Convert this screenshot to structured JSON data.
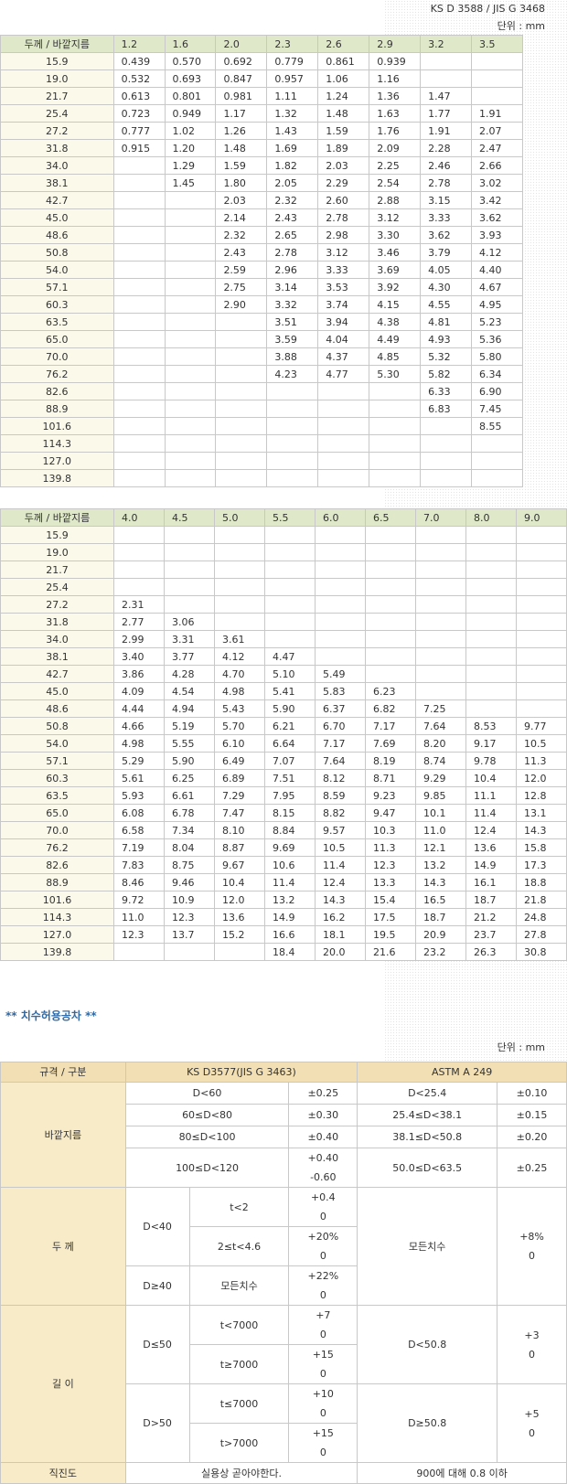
{
  "standard": "KS D 3588 / JIS G 3468",
  "unit": "단위 : mm",
  "weight_table": {
    "corner": "두께 / 바깥지름",
    "od": [
      "15.9",
      "19.0",
      "21.7",
      "25.4",
      "27.2",
      "31.8",
      "34.0",
      "38.1",
      "42.7",
      "45.0",
      "48.6",
      "50.8",
      "54.0",
      "57.1",
      "60.3",
      "63.5",
      "65.0",
      "70.0",
      "76.2",
      "82.6",
      "88.9",
      "101.6",
      "114.3",
      "127.0",
      "139.8"
    ],
    "part1": {
      "thickness": [
        "1.2",
        "1.6",
        "2.0",
        "2.3",
        "2.6",
        "2.9",
        "3.2",
        "3.5"
      ],
      "rows": [
        [
          "0.439",
          "0.570",
          "0.692",
          "0.779",
          "0.861",
          "0.939",
          "",
          ""
        ],
        [
          "0.532",
          "0.693",
          "0.847",
          "0.957",
          "1.06",
          "1.16",
          "",
          ""
        ],
        [
          "0.613",
          "0.801",
          "0.981",
          "1.11",
          "1.24",
          "1.36",
          "1.47",
          ""
        ],
        [
          "0.723",
          "0.949",
          "1.17",
          "1.32",
          "1.48",
          "1.63",
          "1.77",
          "1.91"
        ],
        [
          "0.777",
          "1.02",
          "1.26",
          "1.43",
          "1.59",
          "1.76",
          "1.91",
          "2.07"
        ],
        [
          "0.915",
          "1.20",
          "1.48",
          "1.69",
          "1.89",
          "2.09",
          "2.28",
          "2.47"
        ],
        [
          "",
          "1.29",
          "1.59",
          "1.82",
          "2.03",
          "2.25",
          "2.46",
          "2.66"
        ],
        [
          "",
          "1.45",
          "1.80",
          "2.05",
          "2.29",
          "2.54",
          "2.78",
          "3.02"
        ],
        [
          "",
          "",
          "2.03",
          "2.32",
          "2.60",
          "2.88",
          "3.15",
          "3.42"
        ],
        [
          "",
          "",
          "2.14",
          "2.43",
          "2.78",
          "3.12",
          "3.33",
          "3.62"
        ],
        [
          "",
          "",
          "2.32",
          "2.65",
          "2.98",
          "3.30",
          "3.62",
          "3.93"
        ],
        [
          "",
          "",
          "2.43",
          "2.78",
          "3.12",
          "3.46",
          "3.79",
          "4.12"
        ],
        [
          "",
          "",
          "2.59",
          "2.96",
          "3.33",
          "3.69",
          "4.05",
          "4.40"
        ],
        [
          "",
          "",
          "2.75",
          "3.14",
          "3.53",
          "3.92",
          "4.30",
          "4.67"
        ],
        [
          "",
          "",
          "2.90",
          "3.32",
          "3.74",
          "4.15",
          "4.55",
          "4.95"
        ],
        [
          "",
          "",
          "",
          "3.51",
          "3.94",
          "4.38",
          "4.81",
          "5.23"
        ],
        [
          "",
          "",
          "",
          "3.59",
          "4.04",
          "4.49",
          "4.93",
          "5.36"
        ],
        [
          "",
          "",
          "",
          "3.88",
          "4.37",
          "4.85",
          "5.32",
          "5.80"
        ],
        [
          "",
          "",
          "",
          "4.23",
          "4.77",
          "5.30",
          "5.82",
          "6.34"
        ],
        [
          "",
          "",
          "",
          "",
          "",
          "",
          "6.33",
          "6.90"
        ],
        [
          "",
          "",
          "",
          "",
          "",
          "",
          "6.83",
          "7.45"
        ],
        [
          "",
          "",
          "",
          "",
          "",
          "",
          "",
          "8.55"
        ],
        [
          "",
          "",
          "",
          "",
          "",
          "",
          "",
          ""
        ],
        [
          "",
          "",
          "",
          "",
          "",
          "",
          "",
          ""
        ],
        [
          "",
          "",
          "",
          "",
          "",
          "",
          "",
          ""
        ]
      ]
    },
    "part2": {
      "thickness": [
        "4.0",
        "4.5",
        "5.0",
        "5.5",
        "6.0",
        "6.5",
        "7.0",
        "8.0",
        "9.0"
      ],
      "rows": [
        [
          "",
          "",
          "",
          "",
          "",
          "",
          "",
          "",
          ""
        ],
        [
          "",
          "",
          "",
          "",
          "",
          "",
          "",
          "",
          ""
        ],
        [
          "",
          "",
          "",
          "",
          "",
          "",
          "",
          "",
          ""
        ],
        [
          "",
          "",
          "",
          "",
          "",
          "",
          "",
          "",
          ""
        ],
        [
          "2.31",
          "",
          "",
          "",
          "",
          "",
          "",
          "",
          ""
        ],
        [
          "2.77",
          "3.06",
          "",
          "",
          "",
          "",
          "",
          "",
          ""
        ],
        [
          "2.99",
          "3.31",
          "3.61",
          "",
          "",
          "",
          "",
          "",
          ""
        ],
        [
          "3.40",
          "3.77",
          "4.12",
          "4.47",
          "",
          "",
          "",
          "",
          ""
        ],
        [
          "3.86",
          "4.28",
          "4.70",
          "5.10",
          "5.49",
          "",
          "",
          "",
          ""
        ],
        [
          "4.09",
          "4.54",
          "4.98",
          "5.41",
          "5.83",
          "6.23",
          "",
          "",
          ""
        ],
        [
          "4.44",
          "4.94",
          "5.43",
          "5.90",
          "6.37",
          "6.82",
          "7.25",
          "",
          ""
        ],
        [
          "4.66",
          "5.19",
          "5.70",
          "6.21",
          "6.70",
          "7.17",
          "7.64",
          "8.53",
          "9.77"
        ],
        [
          "4.98",
          "5.55",
          "6.10",
          "6.64",
          "7.17",
          "7.69",
          "8.20",
          "9.17",
          "10.5"
        ],
        [
          "5.29",
          "5.90",
          "6.49",
          "7.07",
          "7.64",
          "8.19",
          "8.74",
          "9.78",
          "11.3"
        ],
        [
          "5.61",
          "6.25",
          "6.89",
          "7.51",
          "8.12",
          "8.71",
          "9.29",
          "10.4",
          "12.0"
        ],
        [
          "5.93",
          "6.61",
          "7.29",
          "7.95",
          "8.59",
          "9.23",
          "9.85",
          "11.1",
          "12.8"
        ],
        [
          "6.08",
          "6.78",
          "7.47",
          "8.15",
          "8.82",
          "9.47",
          "10.1",
          "11.4",
          "13.1"
        ],
        [
          "6.58",
          "7.34",
          "8.10",
          "8.84",
          "9.57",
          "10.3",
          "11.0",
          "12.4",
          "14.3"
        ],
        [
          "7.19",
          "8.04",
          "8.87",
          "9.69",
          "10.5",
          "11.3",
          "12.1",
          "13.6",
          "15.8"
        ],
        [
          "7.83",
          "8.75",
          "9.67",
          "10.6",
          "11.4",
          "12.3",
          "13.2",
          "14.9",
          "17.3"
        ],
        [
          "8.46",
          "9.46",
          "10.4",
          "11.4",
          "12.4",
          "13.3",
          "14.3",
          "16.1",
          "18.8"
        ],
        [
          "9.72",
          "10.9",
          "12.0",
          "13.2",
          "14.3",
          "15.4",
          "16.5",
          "18.7",
          "21.8"
        ],
        [
          "11.0",
          "12.3",
          "13.6",
          "14.9",
          "16.2",
          "17.5",
          "18.7",
          "21.2",
          "24.8"
        ],
        [
          "12.3",
          "13.7",
          "15.2",
          "16.6",
          "18.1",
          "19.5",
          "20.9",
          "23.7",
          "27.8"
        ],
        [
          "",
          "",
          "",
          "18.4",
          "20.0",
          "21.6",
          "23.2",
          "26.3",
          "30.8"
        ]
      ]
    }
  },
  "tolerance": {
    "title": "** 치수허용공차 **",
    "unit": "단위 : mm",
    "head": {
      "spec": "규격 / 구분",
      "ks": "KS D3577(JIS G 3463)",
      "astm": "ASTM A 249"
    },
    "outer_diameter": {
      "label": "바깥지름",
      "rows": [
        {
          "ks_range": "D<60",
          "ks_tol": "±0.25",
          "astm_range": "D<25.4",
          "astm_tol": "±0.10"
        },
        {
          "ks_range": "60≤D<80",
          "ks_tol": "±0.30",
          "astm_range": "25.4≤D<38.1",
          "astm_tol": "±0.15"
        },
        {
          "ks_range": "80≤D<100",
          "ks_tol": "±0.40",
          "astm_range": "38.1≤D<50.8",
          "astm_tol": "±0.20"
        },
        {
          "ks_range": "100≤D<120",
          "ks_tol_top": "+0.40",
          "ks_tol_bottom": "-0.60",
          "astm_range": "50.0≤D<63.5",
          "astm_tol": "±0.25"
        }
      ]
    },
    "thickness": {
      "label": "두   께",
      "d_small": "D<40",
      "d_large": "D≥40",
      "r1_cond": "t<2",
      "r1_top": "+0.4",
      "r1_bottom": "0",
      "r2_cond": "2≤t<4.6",
      "r2_top": "+20%",
      "r2_bottom": "0",
      "r3_cond": "모든치수",
      "r3_top": "+22%",
      "r3_bottom": "0",
      "astm_range": "모든치수",
      "astm_top": "+8%",
      "astm_bottom": "0"
    },
    "length": {
      "label": "길   이",
      "d_small": "D≤50",
      "d_large": "D>50",
      "r1_cond": "t<7000",
      "r1_top": "+7",
      "r1_bottom": "0",
      "r2_cond": "t≥7000",
      "r2_top": "+15",
      "r2_bottom": "0",
      "r3_cond": "t≤7000",
      "r3_top": "+10",
      "r3_bottom": "0",
      "r4_cond": "t>7000",
      "r4_top": "+15",
      "r4_bottom": "0",
      "astm_small": "D<50.8",
      "astm_small_top": "+3",
      "astm_small_bottom": "0",
      "astm_large": "D≥50.8",
      "astm_large_top": "+5",
      "astm_large_bottom": "0"
    },
    "straightness": {
      "label": "직진도",
      "ks": "실용상 곧아야한다.",
      "astm": "900에 대해 0.8 이하"
    }
  }
}
